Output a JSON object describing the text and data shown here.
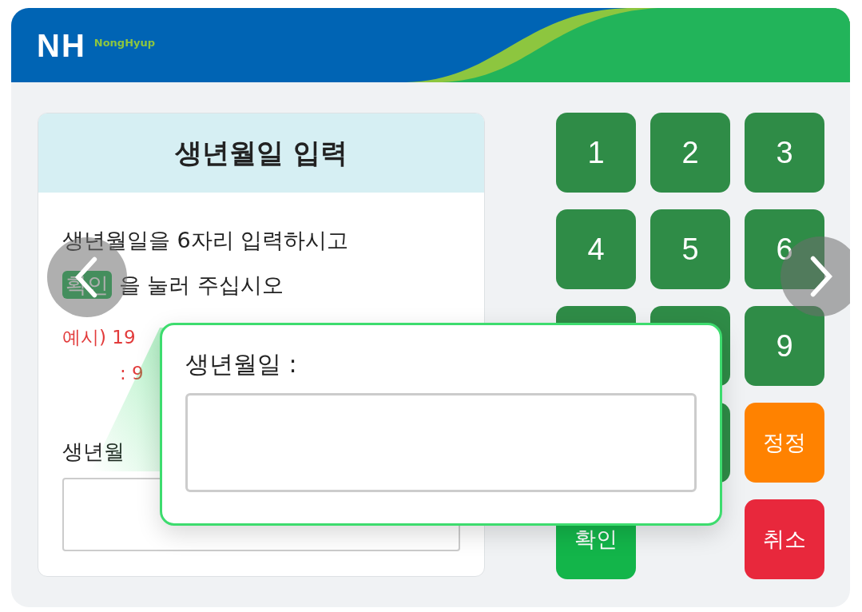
{
  "header": {
    "logo_mark": "NH",
    "logo_text": "NongHyup"
  },
  "card": {
    "title": "생년월일 입력",
    "instruction_line1": "생년월일을 6자리 입력하시고",
    "confirm_badge": "확인",
    "instruction_line2": "을 눌러 주십시오",
    "example_line1": "예시) 19",
    "example_line2": ": 9",
    "field_label": "생년월"
  },
  "keypad": [
    {
      "kind": "digit",
      "label": "1"
    },
    {
      "kind": "digit",
      "label": "2"
    },
    {
      "kind": "digit",
      "label": "3"
    },
    {
      "kind": "digit",
      "label": "4"
    },
    {
      "kind": "digit",
      "label": "5"
    },
    {
      "kind": "digit",
      "label": "6"
    },
    {
      "kind": "covered"
    },
    {
      "kind": "covered"
    },
    {
      "kind": "digit",
      "label": "9"
    },
    {
      "kind": "hidden"
    },
    {
      "kind": "covered"
    },
    {
      "kind": "correct",
      "label": "정정"
    },
    {
      "kind": "confirm",
      "label": "확인"
    },
    {
      "kind": "empty"
    },
    {
      "kind": "cancel",
      "label": "취소"
    }
  ],
  "popup": {
    "label": "생년월일 :"
  }
}
